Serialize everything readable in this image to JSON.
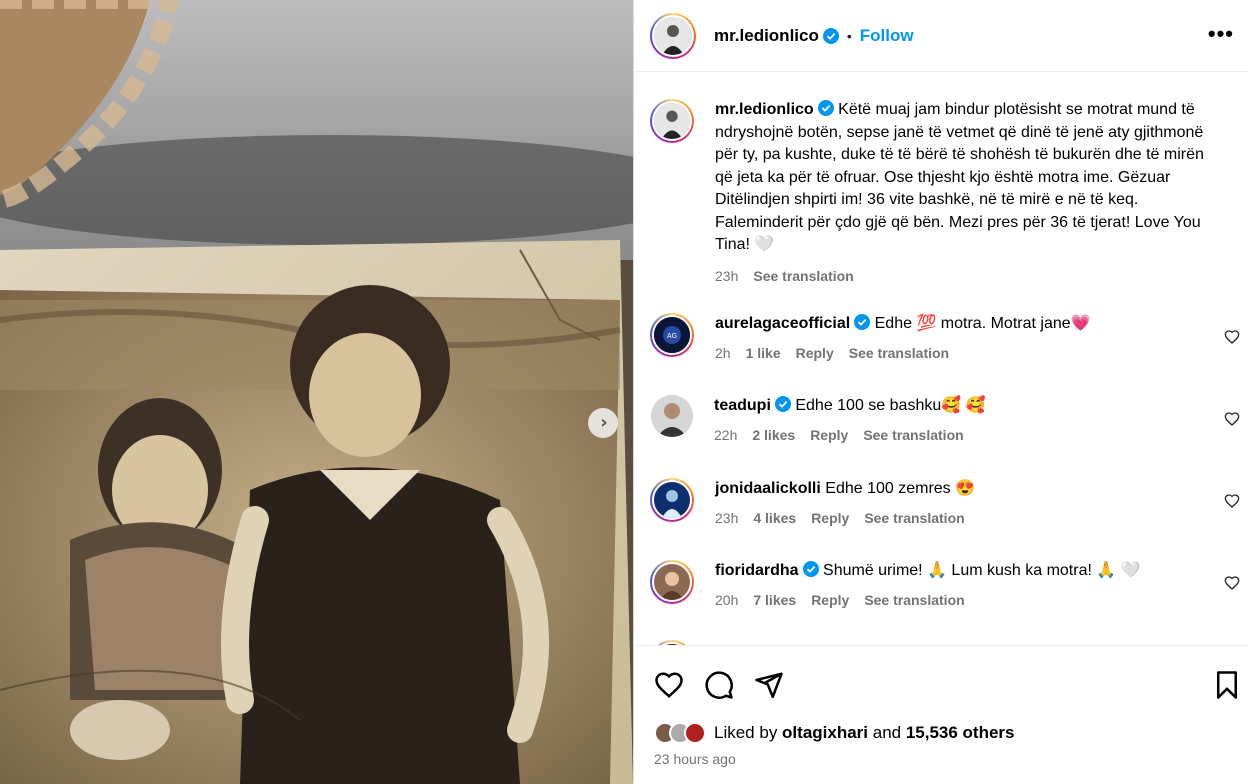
{
  "post": {
    "username": "mr.ledionlico",
    "follow_label": "Follow",
    "dot": "•",
    "more_label": "•••",
    "caption_user": "mr.ledionlico",
    "caption": "Këtë muaj jam bindur plotësisht se motrat mund të ndryshojnë botën, sepse janë të vetmet që dinë të jenë aty gjithmonë për ty, pa kushte, duke të të bërë të shohësh të bukurën dhe të mirën që jeta ka për të ofruar. Ose thjesht kjo është motra ime. Gëzuar Ditëlindjen shpirti im! 36 vite bashkë, në të mirë e në të keq. Faleminderit për çdo gjë që bën. Mezi pres për 36 të tjerat! Love You Tina! 🤍",
    "caption_time": "23h",
    "see_translation": "See translation"
  },
  "comments": [
    {
      "user": "aurelagaceofficial",
      "verified": true,
      "text": "Edhe 💯 motra. Motrat jane💗",
      "time": "2h",
      "likes": "1 like",
      "reply": "Reply",
      "translate": "See translation"
    },
    {
      "user": "teadupi",
      "verified": true,
      "text": "Edhe 100 se bashku🥰 🥰",
      "time": "22h",
      "likes": "2 likes",
      "reply": "Reply",
      "translate": "See translation"
    },
    {
      "user": "jonidaalickolli",
      "verified": false,
      "text": "Edhe 100 zemres 😍",
      "time": "23h",
      "likes": "4 likes",
      "reply": "Reply",
      "translate": "See translation"
    },
    {
      "user": "fioridardha",
      "verified": true,
      "text": "Shumë urime! 🙏 Lum kush ka motra! 🙏 🤍",
      "time": "20h",
      "likes": "7 likes",
      "reply": "Reply",
      "translate": "See translation"
    }
  ],
  "footer": {
    "liked_prefix": "Liked by ",
    "liked_user": "oltagixhari",
    "liked_mid": " and ",
    "liked_count": "15,536 others",
    "time_ago": "23 hours ago"
  },
  "colors": {
    "accent": "#0095f6",
    "verified": "#0095f6",
    "muted": "#737373"
  },
  "icons": [
    "heart-icon",
    "comment-icon",
    "share-icon",
    "bookmark-icon",
    "chevron-right-icon",
    "verified-icon",
    "more-icon"
  ]
}
